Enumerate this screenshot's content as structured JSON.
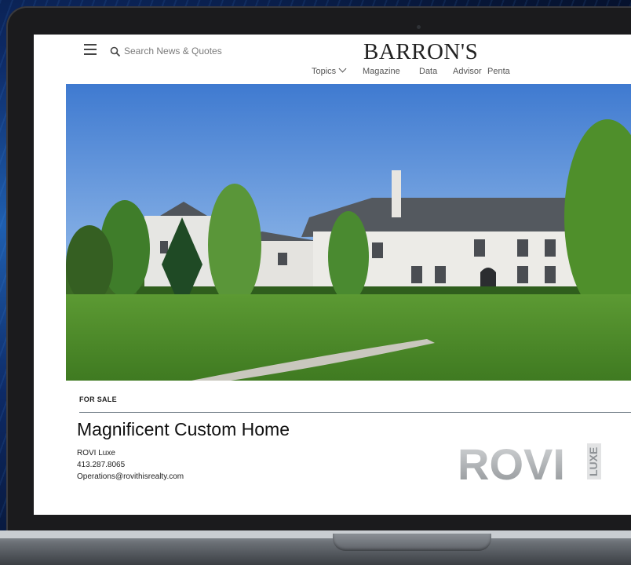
{
  "header": {
    "search_placeholder": "Search News & Quotes",
    "logo": "BARRON'S",
    "nav": {
      "topics": "Topics",
      "magazine": "Magazine",
      "data": "Data",
      "advisor": "Advisor",
      "penta": "Penta"
    }
  },
  "listing": {
    "label": "FOR SALE",
    "title": "Magnificent Custom Home",
    "agent_name": "ROVI Luxe",
    "agent_phone": "413.287.8065",
    "agent_email": "Operations@rovithisrealty.com",
    "brand_logo": "ROVI",
    "brand_sub": "LUXE"
  },
  "colors": {
    "rule": "#6f7b85",
    "sky": "#5b8ed6",
    "lawn": "#4e8a2a"
  },
  "icons": [
    "menu-icon",
    "search-icon",
    "chevron-down-icon"
  ]
}
